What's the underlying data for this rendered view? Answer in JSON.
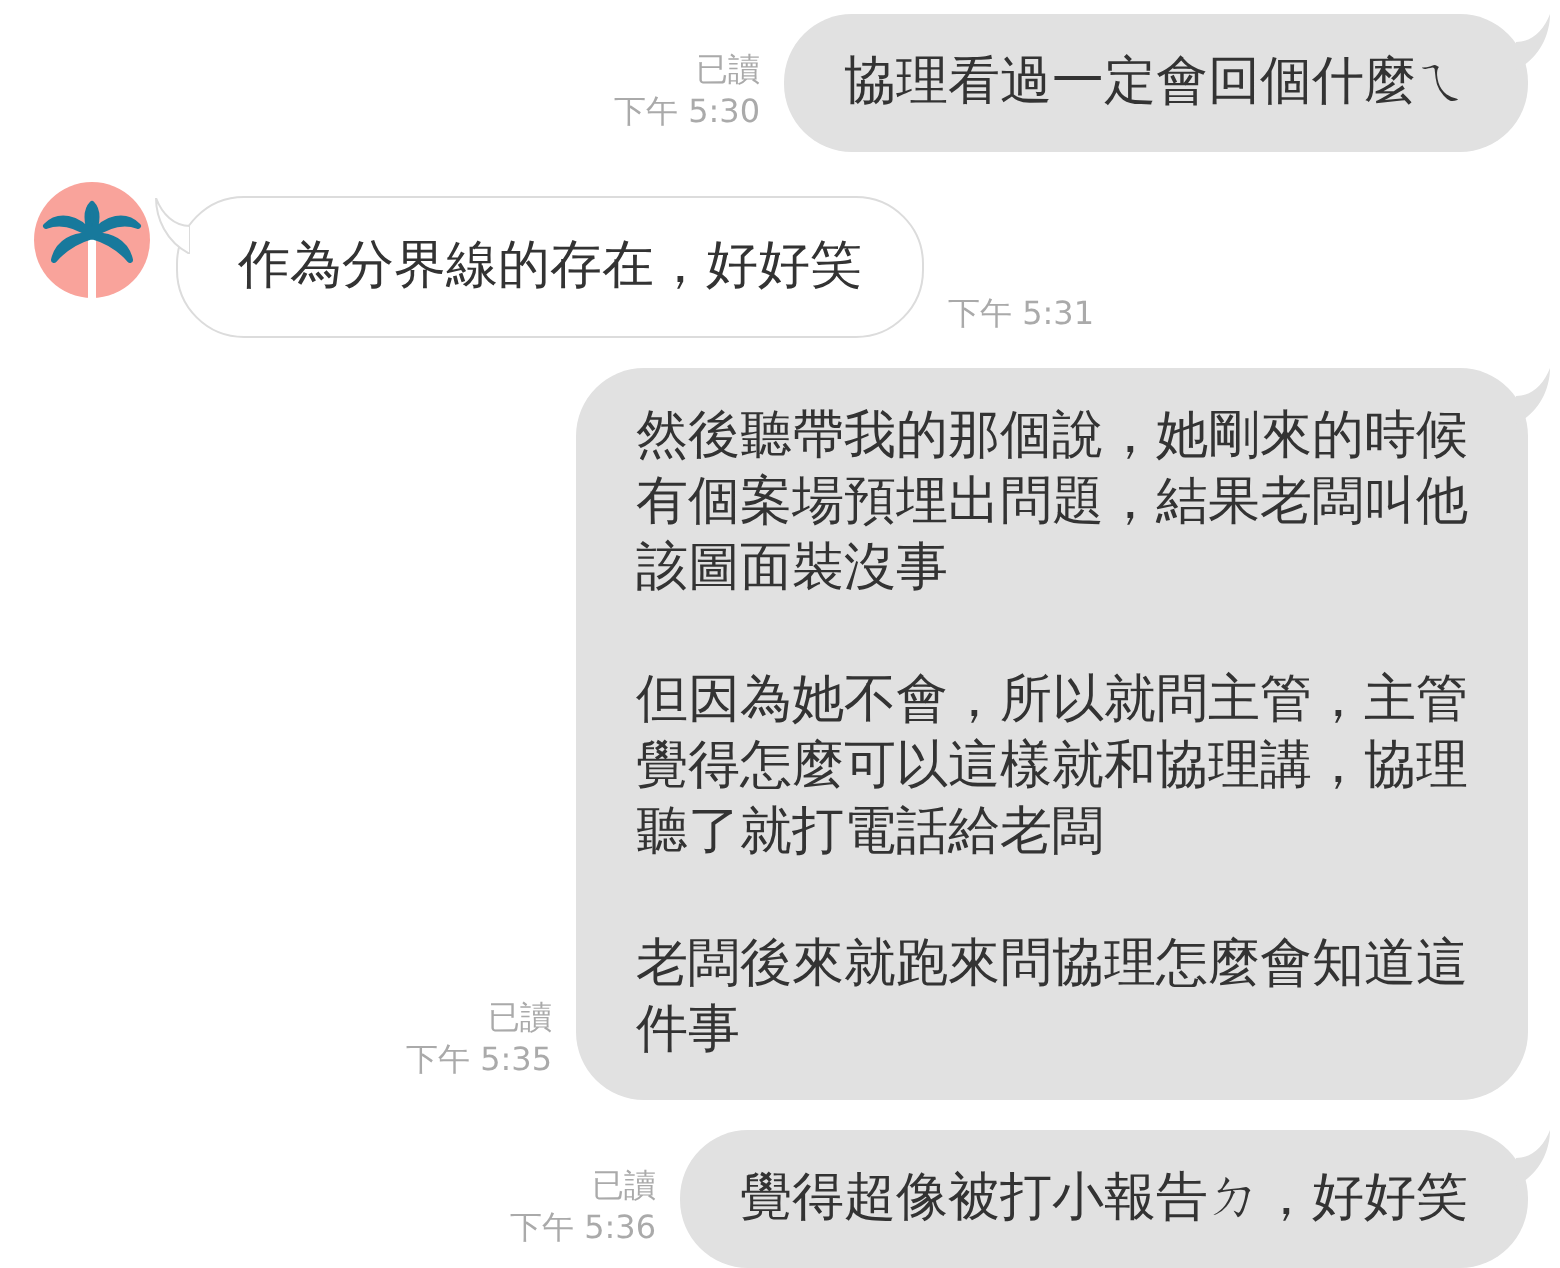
{
  "messages": [
    {
      "kind": "sent",
      "read": "已讀",
      "time": "下午 5:30",
      "paragraphs": [
        "協理看過一定會回個什麼ㄟ"
      ]
    },
    {
      "kind": "received",
      "time": "下午 5:31",
      "paragraphs": [
        "作為分界線的存在，好好笑"
      ]
    },
    {
      "kind": "sent",
      "read": "已讀",
      "time": "下午 5:35",
      "paragraphs": [
        "然後聽帶我的那個說，她剛來的時候有個案場預埋出問題，結果老闆叫他該圖面裝沒事",
        "但因為她不會，所以就問主管，主管覺得怎麼可以這樣就和協理講，協理聽了就打電話給老闆",
        "老闆後來就跑來問協理怎麼會知道這件事"
      ]
    },
    {
      "kind": "sent",
      "read": "已讀",
      "time": "下午 5:36",
      "paragraphs": [
        "覺得超像被打小報告ㄉ，好好笑"
      ]
    }
  ]
}
